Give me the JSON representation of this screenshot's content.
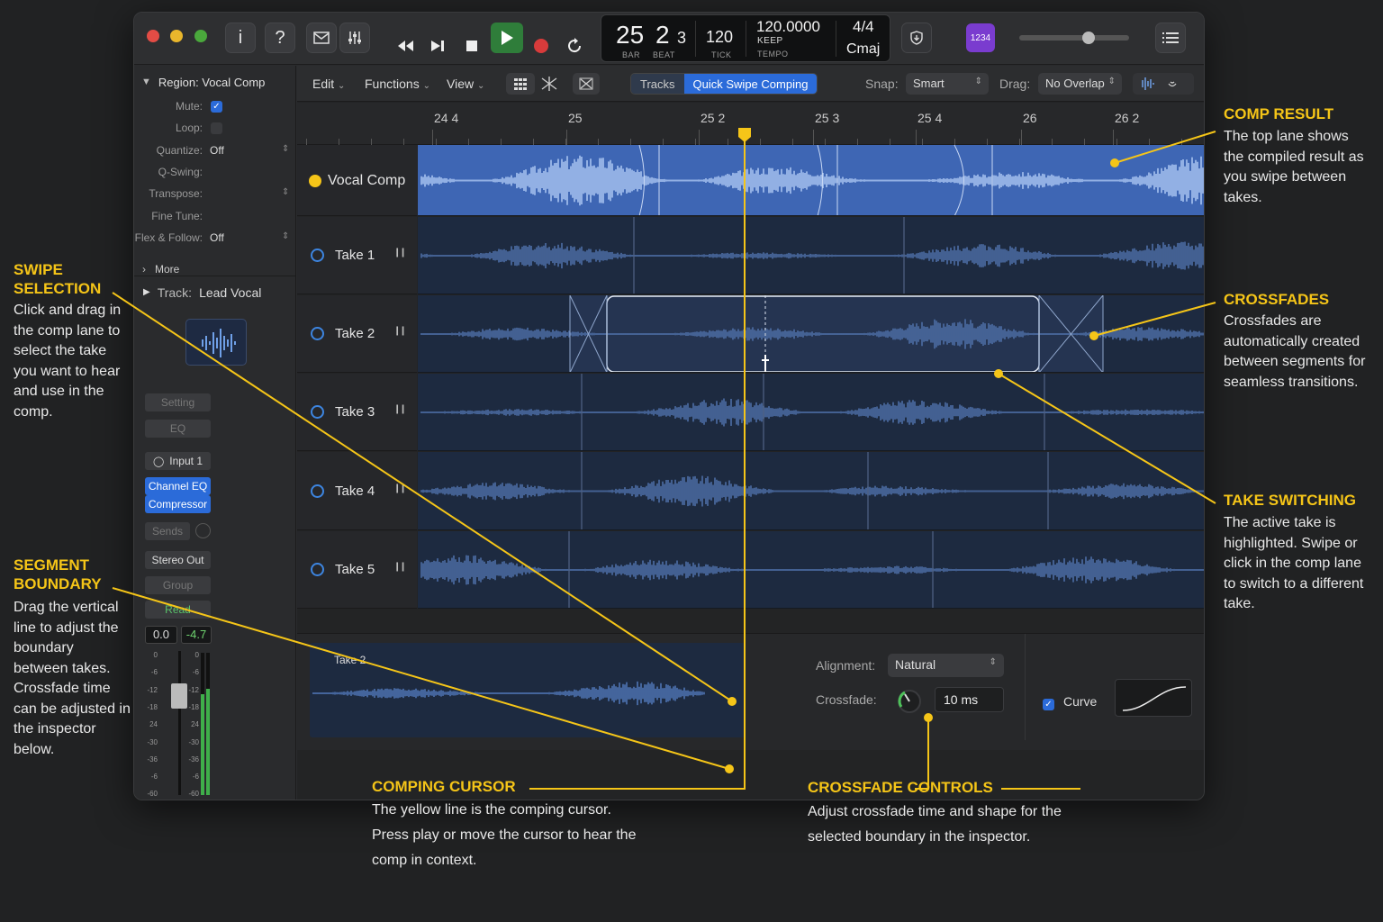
{
  "lcd": {
    "bar": "25",
    "beat": "2",
    "sub": "3",
    "bar_label": "BAR",
    "beat_label": "BEAT",
    "tempo": "120",
    "tick_label": "TICK",
    "tempo_precise": "120.0000",
    "keep_label": "KEEP",
    "tempo_label": "TEMPO",
    "signature": "4/4",
    "key": "Cmaj"
  },
  "toolbar": {
    "avatar": "1234",
    "info": "i",
    "help": "?"
  },
  "inspector": {
    "region_title": "Region: Vocal Comp",
    "rows": [
      {
        "label": "Mute:",
        "value": ""
      },
      {
        "label": "Loop:",
        "value": ""
      },
      {
        "label": "Quantize:",
        "value": "Off"
      },
      {
        "label": "Q-Swing:",
        "value": ""
      },
      {
        "label": "Transpose:",
        "value": ""
      },
      {
        "label": "Fine Tune:",
        "value": ""
      },
      {
        "label": "Flex & Follow:",
        "value": "Off"
      }
    ],
    "more": "More",
    "track_label": "Track:",
    "track_name": "Lead Vocal",
    "setting": "Setting",
    "eq": "EQ",
    "input": "Input 1",
    "plugin1": "Channel EQ",
    "plugin2": "Compressor",
    "sends": "Sends",
    "output": "Stereo Out",
    "group": "Group",
    "automation": "Read",
    "pan_value": "0.0",
    "level_value": "-4.7",
    "scale": [
      "0",
      "-6",
      "-12",
      "-18",
      "24",
      "-30",
      "-36",
      "-6",
      "-60"
    ]
  },
  "local_toolbar": {
    "edit": "Edit",
    "functions": "Functions",
    "view": "View",
    "tab_tracks": "Tracks",
    "tab_qsc": "Quick Swipe Comping",
    "snap_label": "Snap:",
    "snap_value": "Smart",
    "drag_label": "Drag:",
    "drag_value": "No Overlap"
  },
  "ruler": [
    "24 4",
    "25",
    "25 2",
    "25 3",
    "25 4",
    "26",
    "26 2"
  ],
  "lanes": [
    {
      "name": "Vocal Comp"
    },
    {
      "name": "Take 1"
    },
    {
      "name": "Take 2"
    },
    {
      "name": "Take 3"
    },
    {
      "name": "Take 4"
    },
    {
      "name": "Take 5"
    }
  ],
  "bottom": {
    "take_label": "Take 2",
    "alignment_label": "Alignment:",
    "alignment_value": "Natural",
    "crossfade_label": "Crossfade:",
    "crossfade_value": "10 ms",
    "curve_label": "Curve"
  },
  "annotations": {
    "comp_result": {
      "title": "COMP RESULT",
      "text": "The top lane shows the compiled result as you swipe between takes."
    },
    "swipe": {
      "title1": "SWIPE",
      "title2": "SELECTION",
      "text": "Click and drag in the comp lane to select the take you want to hear and use in the comp."
    },
    "crossfades": {
      "title": "CROSSFADES",
      "text": "Crossfades are automatically created between segments for seamless transitions."
    },
    "take_switching": {
      "title": "TAKE SWITCHING",
      "text": "The active take is highlighted. Swipe or click in the comp lane to switch to a different take."
    },
    "segment": {
      "title1": "SEGMENT",
      "title2": "BOUNDARY",
      "text": "Drag the vertical line to adjust the boundary between takes. Crossfade time can be adjusted in the inspector below."
    },
    "cursor": {
      "title": "COMPING CURSOR",
      "text": "The yellow line is the comping cursor. Press play or move the cursor to hear the comp in context."
    },
    "xfade_controls": {
      "title": "CROSSFADE CONTROLS",
      "text": "Adjust crossfade time and shape for the selected boundary in the inspector."
    }
  },
  "colors": {
    "accent": "#f5c518",
    "comp_lane": "#3e66b4",
    "take_lane": "#1d2a40",
    "selection_blue": "#2b6bd9",
    "play_green": "#2f7d3a",
    "record_red": "#d83b3b"
  }
}
